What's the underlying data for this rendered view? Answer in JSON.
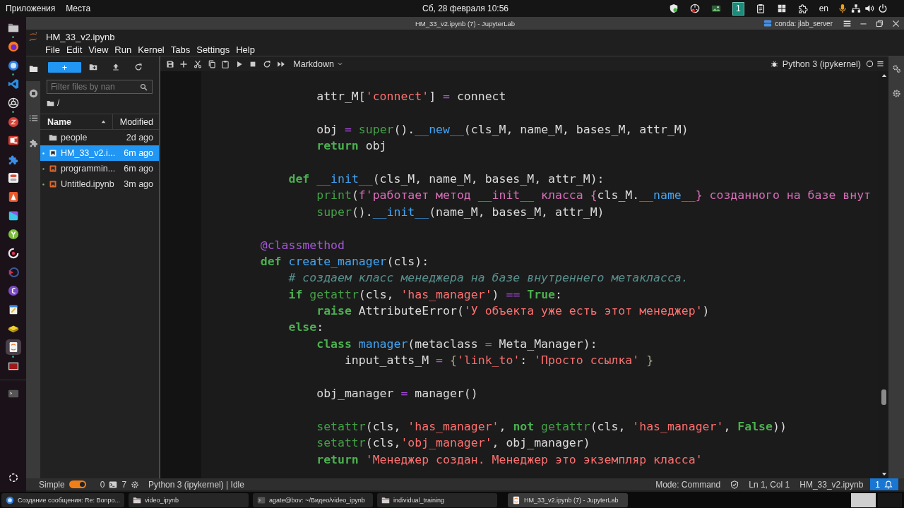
{
  "top_panel": {
    "menus": [
      "Приложения",
      "Места"
    ],
    "clock": "Сб, 28 февраля 10:56",
    "workspace": "1",
    "keyboard_layout": "en"
  },
  "dock": [
    {
      "running": true,
      "selected": false
    },
    {
      "running": false,
      "selected": false
    },
    {
      "running": true,
      "selected": false
    },
    {
      "running": false,
      "selected": false
    },
    {
      "running": true,
      "selected": false
    },
    {
      "running": false,
      "selected": false
    },
    {
      "running": false,
      "selected": false
    },
    {
      "running": false,
      "selected": false
    },
    {
      "running": false,
      "selected": false
    },
    {
      "running": false,
      "selected": false
    },
    {
      "running": false,
      "selected": false
    },
    {
      "running": false,
      "selected": false
    },
    {
      "running": false,
      "selected": false
    },
    {
      "running": false,
      "selected": false
    },
    {
      "running": false,
      "selected": false
    },
    {
      "running": false,
      "selected": false
    },
    {
      "running": false,
      "selected": false
    },
    {
      "running": true,
      "selected": true
    },
    {
      "running": false,
      "selected": false
    },
    {
      "running": false,
      "selected": false
    }
  ],
  "window": {
    "title": "HM_33_v2.ipynb (7) - JupyterLab",
    "environment": "conda: jlab_server"
  },
  "jupyter": {
    "document_title": "HM_33_v2.ipynb",
    "menu": [
      "File",
      "Edit",
      "View",
      "Run",
      "Kernel",
      "Tabs",
      "Settings",
      "Help"
    ]
  },
  "left_sidebar_tabs": [
    {
      "selected": true
    },
    {
      "selected": false
    },
    {
      "selected": false
    },
    {
      "selected": false
    }
  ],
  "file_browser": {
    "new_button": "+",
    "filter": {
      "placeholder": "Filter files by nan"
    },
    "path": "/",
    "columns": [
      "Name",
      "Modified"
    ],
    "rows": [
      {
        "kind": "folder",
        "name": "people",
        "modified": "2d ago",
        "selected": false,
        "running": false
      },
      {
        "kind": "notebook",
        "name": "HM_33_v2.i...",
        "modified": "6m ago",
        "selected": true,
        "running": true
      },
      {
        "kind": "notebook",
        "name": "programmin...",
        "modified": "6m ago",
        "selected": false,
        "running": true
      },
      {
        "kind": "notebook",
        "name": "Untitled.ipynb",
        "modified": "3m ago",
        "selected": false,
        "running": true
      }
    ]
  },
  "notebook": {
    "toolbar": {
      "cell_type": "Markdown",
      "kernel": "Python 3 (ipykernel)",
      "kernel_busy": false
    },
    "lines": [
      {
        "kind": "block",
        "children": [
          {
            "kind": "block",
            "children": [
              {
                "kind": "block",
                "children": [
                  {
                    "kind": "code",
                    "tokens": [
                      {
                        "kind": "plain",
                        "text": "attr_M["
                      },
                      {
                        "kind": "str",
                        "text": "'connect'"
                      },
                      {
                        "kind": "plain",
                        "text": "]"
                      },
                      {
                        "kind": "op",
                        "text": " = "
                      },
                      {
                        "kind": "plain",
                        "text": "connect"
                      }
                    ]
                  },
                  {
                    "kind": "blank"
                  },
                  {
                    "kind": "code",
                    "tokens": [
                      {
                        "kind": "plain",
                        "text": "obj"
                      },
                      {
                        "kind": "op",
                        "text": " = "
                      },
                      {
                        "kind": "builtin",
                        "text": "super"
                      },
                      {
                        "kind": "plain",
                        "text": "()."
                      },
                      {
                        "kind": "prop",
                        "text": "__new__"
                      },
                      {
                        "kind": "plain",
                        "text": "(cls_M, name_M, bases_M, attr_M)"
                      }
                    ]
                  },
                  {
                    "kind": "code",
                    "tokens": [
                      {
                        "kind": "kw",
                        "text": "return"
                      },
                      {
                        "kind": "plain",
                        "text": " obj"
                      }
                    ]
                  }
                ]
              },
              {
                "kind": "blank"
              },
              {
                "kind": "code",
                "tokens": [
                  {
                    "kind": "kw",
                    "text": "def"
                  },
                  {
                    "kind": "def",
                    "text": " __init__"
                  },
                  {
                    "kind": "plain",
                    "text": "(cls_M, name_M, bases_M, attr_M):"
                  }
                ],
                "children": [
                  {
                    "kind": "code",
                    "tokens": [
                      {
                        "kind": "builtin",
                        "text": "print"
                      },
                      {
                        "kind": "plain",
                        "text": "("
                      },
                      {
                        "kind": "fstr",
                        "text": "f'работает метод __init__ класса {"
                      },
                      {
                        "kind": "plain",
                        "text": "cls_M."
                      },
                      {
                        "kind": "prop",
                        "text": "__name__"
                      },
                      {
                        "kind": "fstr",
                        "text": "} созданного на базе внут"
                      }
                    ]
                  },
                  {
                    "kind": "code",
                    "tokens": [
                      {
                        "kind": "builtin",
                        "text": "super"
                      },
                      {
                        "kind": "plain",
                        "text": "()."
                      },
                      {
                        "kind": "prop",
                        "text": "__init__"
                      },
                      {
                        "kind": "plain",
                        "text": "(name_M, bases_M, attr_M)"
                      }
                    ]
                  }
                ]
              }
            ]
          },
          {
            "kind": "blank"
          },
          {
            "kind": "code",
            "tokens": [
              {
                "kind": "meta",
                "text": "@classmethod"
              }
            ]
          },
          {
            "kind": "code",
            "tokens": [
              {
                "kind": "kw",
                "text": "def"
              },
              {
                "kind": "def",
                "text": " create_manager"
              },
              {
                "kind": "plain",
                "text": "(cls):"
              }
            ],
            "children": [
              {
                "kind": "code",
                "tokens": [
                  {
                    "kind": "cmt",
                    "text": "# создаем класс менеджера на базе внутреннего метакласса."
                  }
                ]
              },
              {
                "kind": "code",
                "tokens": [
                  {
                    "kind": "kw",
                    "text": "if"
                  },
                  {
                    "kind": "builtin",
                    "text": " getattr"
                  },
                  {
                    "kind": "plain",
                    "text": "(cls, "
                  },
                  {
                    "kind": "str",
                    "text": "'has_manager'"
                  },
                  {
                    "kind": "plain",
                    "text": ")"
                  },
                  {
                    "kind": "op",
                    "text": " == "
                  },
                  {
                    "kind": "kw",
                    "text": "True"
                  },
                  {
                    "kind": "plain",
                    "text": ":"
                  }
                ],
                "children": [
                  {
                    "kind": "code",
                    "tokens": [
                      {
                        "kind": "kw",
                        "text": "raise"
                      },
                      {
                        "kind": "plain",
                        "text": " AttributeError("
                      },
                      {
                        "kind": "str",
                        "text": "'У объекта уже есть этот менеджер'"
                      },
                      {
                        "kind": "plain",
                        "text": ")"
                      }
                    ]
                  }
                ]
              },
              {
                "kind": "code",
                "tokens": [
                  {
                    "kind": "kw",
                    "text": "else"
                  },
                  {
                    "kind": "plain",
                    "text": ":"
                  }
                ],
                "children": [
                  {
                    "kind": "code",
                    "tokens": [
                      {
                        "kind": "kw",
                        "text": "class"
                      },
                      {
                        "kind": "def",
                        "text": " manager"
                      },
                      {
                        "kind": "plain",
                        "text": "(metaclass"
                      },
                      {
                        "kind": "op",
                        "text": " = "
                      },
                      {
                        "kind": "plain",
                        "text": "Meta_Manager):"
                      }
                    ],
                    "children": [
                      {
                        "kind": "code",
                        "tokens": [
                          {
                            "kind": "plain",
                            "text": "input_atts_M"
                          },
                          {
                            "kind": "op",
                            "text": " = "
                          },
                          {
                            "kind": "bracket",
                            "text": "{"
                          },
                          {
                            "kind": "str",
                            "text": "'link_to'"
                          },
                          {
                            "kind": "plain",
                            "text": ": "
                          },
                          {
                            "kind": "str",
                            "text": "'Просто ссылка'"
                          },
                          {
                            "kind": "bracket",
                            "text": " }"
                          }
                        ]
                      }
                    ]
                  },
                  {
                    "kind": "blank"
                  },
                  {
                    "kind": "code",
                    "tokens": [
                      {
                        "kind": "plain",
                        "text": "obj_manager"
                      },
                      {
                        "kind": "op",
                        "text": " = "
                      },
                      {
                        "kind": "plain",
                        "text": "manager()"
                      }
                    ]
                  },
                  {
                    "kind": "blank"
                  },
                  {
                    "kind": "code",
                    "tokens": [
                      {
                        "kind": "builtin",
                        "text": "setattr"
                      },
                      {
                        "kind": "plain",
                        "text": "(cls, "
                      },
                      {
                        "kind": "str",
                        "text": "'has_manager'"
                      },
                      {
                        "kind": "plain",
                        "text": ", "
                      },
                      {
                        "kind": "kw",
                        "text": "not"
                      },
                      {
                        "kind": "builtin",
                        "text": " getattr"
                      },
                      {
                        "kind": "plain",
                        "text": "(cls, "
                      },
                      {
                        "kind": "str",
                        "text": "'has_manager'"
                      },
                      {
                        "kind": "plain",
                        "text": ", "
                      },
                      {
                        "kind": "kw",
                        "text": "False"
                      },
                      {
                        "kind": "plain",
                        "text": "))"
                      }
                    ]
                  },
                  {
                    "kind": "code",
                    "tokens": [
                      {
                        "kind": "builtin",
                        "text": "setattr"
                      },
                      {
                        "kind": "plain",
                        "text": "(cls,"
                      },
                      {
                        "kind": "str",
                        "text": "'obj_manager'"
                      },
                      {
                        "kind": "plain",
                        "text": ", obj_manager)"
                      }
                    ]
                  },
                  {
                    "kind": "code",
                    "tokens": [
                      {
                        "kind": "kw",
                        "text": "return"
                      },
                      {
                        "kind": "str",
                        "text": " 'Менеджер создан. Менеджер это экземпляр класса'"
                      }
                    ]
                  }
                ]
              }
            ]
          }
        ]
      }
    ]
  },
  "status_bar": {
    "simple_mode": {
      "label": "Simple",
      "on": true
    },
    "terminals": "0",
    "kernels": "7",
    "kernel_status": "Python 3 (ipykernel) | Idle",
    "mode": "Mode: Command",
    "cursor": "Ln 1, Col 1",
    "file": "HM_33_v2.ipynb",
    "notifications": "1"
  },
  "taskbar": [
    {
      "label": "Создание сообщения: Re: Вопро...",
      "selected": false
    },
    {
      "label": "video_ipynb",
      "selected": false
    },
    {
      "label": "agate@bov: ~/Видео/video_ipynb",
      "selected": false
    },
    {
      "label": "individual_training",
      "selected": false
    },
    {
      "label": "HM_33_v2.ipynb (7) - JupyterLab",
      "selected": true
    }
  ]
}
